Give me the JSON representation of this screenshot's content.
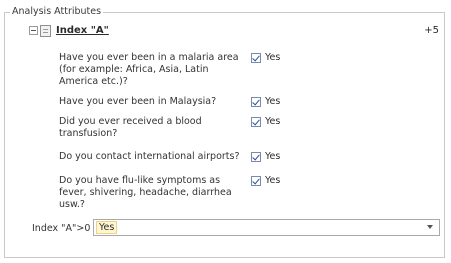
{
  "group": {
    "title": "Analysis Attributes"
  },
  "node": {
    "title": "Index \"A\"",
    "count": "+5"
  },
  "questions": [
    {
      "text": "Have you ever been in a malaria area (for example: Africa, Asia, Latin America etc.)?",
      "answer": "Yes",
      "checked": true
    },
    {
      "text": "Have you ever been in Malaysia?",
      "answer": "Yes",
      "checked": true
    },
    {
      "text": "Did you ever received a blood transfusion?",
      "answer": "Yes",
      "checked": true
    },
    {
      "text": "Do you contact international airports?",
      "answer": "Yes",
      "checked": true
    },
    {
      "text": "Do you have flu-like symptoms as fever, shivering, headache, diarrhea usw.?",
      "answer": "Yes",
      "checked": true
    }
  ],
  "condition": {
    "label": "Index \"A\">0",
    "value": "Yes"
  },
  "icons": {
    "expander": "collapse-icon",
    "node": "list-icon",
    "dropdown": "chevron-down-icon"
  }
}
